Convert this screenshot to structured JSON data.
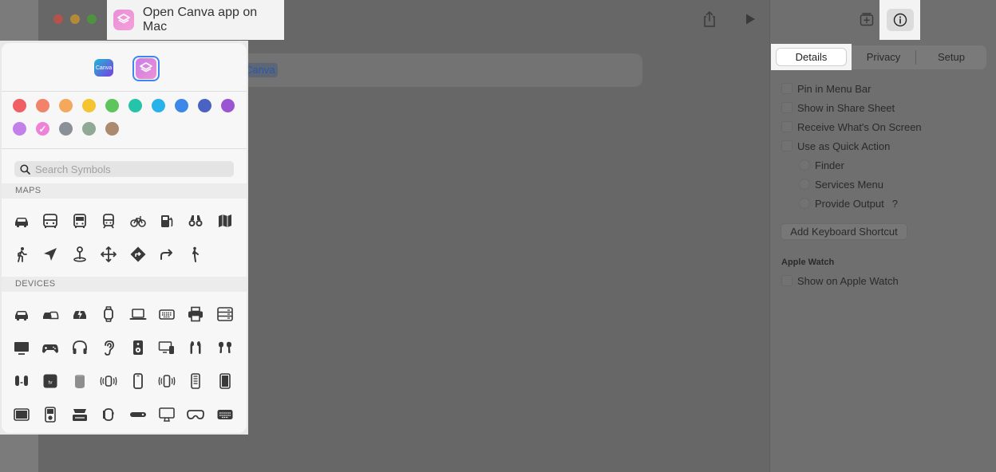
{
  "window": {
    "title": "Open Canva app on Mac"
  },
  "action": {
    "variable_token": "Canva"
  },
  "inspector": {
    "tabs": [
      "Details",
      "Privacy",
      "Setup"
    ],
    "options": [
      "Pin in Menu Bar",
      "Show in Share Sheet",
      "Receive What's On Screen",
      "Use as Quick Action"
    ],
    "quick_action_suboptions": [
      "Finder",
      "Services Menu",
      "Provide Output"
    ],
    "help_mark": "?",
    "keyboard_shortcut_button": "Add Keyboard Shortcut",
    "apple_watch_heading": "Apple Watch",
    "apple_watch_option": "Show on Apple Watch"
  },
  "icon_picker": {
    "canva_tab_label": "Canva",
    "search_placeholder": "Search Symbols",
    "categories": [
      "MAPS",
      "DEVICES"
    ],
    "colors": [
      "#ef5f63",
      "#f2836b",
      "#f3a85c",
      "#f5c431",
      "#5dc55b",
      "#25c3a8",
      "#27b2ec",
      "#3c88e8",
      "#4a63c2",
      "#9a55d3",
      "#c380ea",
      "#ed82d7",
      "#8a8f98",
      "#8fa994",
      "#ab8a70"
    ],
    "selected_color": "#ed82d7",
    "check_mark": "✓",
    "maps_symbols": [
      "car-icon",
      "bus-icon",
      "bus-front-icon",
      "tram-icon",
      "bicycle-icon",
      "fuel-pump-icon",
      "binoculars-icon",
      "map-icon",
      "walking-figure-icon",
      "location-arrow-icon",
      "map-pin-icon",
      "move-arrows-icon",
      "directions-sign-icon",
      "turn-right-arrow-icon",
      "figure-standing-icon"
    ],
    "devices_symbols": [
      "car-icon",
      "two-cars-icon",
      "bolt-car-icon",
      "watch-icon",
      "laptop-icon",
      "keyboard-icon",
      "printer-icon",
      "server-rack-icon",
      "monitor-icon",
      "gamecontroller-icon",
      "headphones-icon",
      "ear-icon",
      "speaker-icon",
      "display-and-phone-icon",
      "airpods-icon",
      "airpods-pro-icon",
      "airpods-case-icon",
      "apple-tv-icon",
      "homepod-icon",
      "watch-waves-icon",
      "iphone-icon",
      "iphone-waves-icon",
      "ipod-icon",
      "ipad-icon",
      "ipad-landscape-icon",
      "ipod-classic-icon",
      "scanner-icon",
      "watch-side-icon",
      "tv-remote-icon",
      "desktop-icon",
      "vision-pro-icon",
      "keyboard-compact-icon"
    ]
  }
}
